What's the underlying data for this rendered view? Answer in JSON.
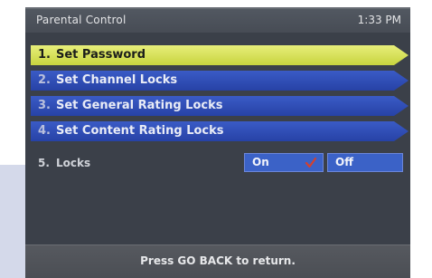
{
  "header": {
    "title": "Parental Control",
    "time": "1:33 PM"
  },
  "menu": {
    "items": [
      {
        "number": "1.",
        "label": "Set Password",
        "selected": true
      },
      {
        "number": "2.",
        "label": "Set Channel Locks",
        "selected": false
      },
      {
        "number": "3.",
        "label": "Set General Rating Locks",
        "selected": false
      },
      {
        "number": "4.",
        "label": "Set Content Rating Locks",
        "selected": false
      }
    ]
  },
  "locks": {
    "number": "5.",
    "label": "Locks",
    "on_label": "On",
    "off_label": "Off",
    "selected": "On"
  },
  "footer": {
    "hint": "Press GO BACK to return."
  },
  "colors": {
    "selected_item": "#d9e35a",
    "menu_item": "#2f4fb8",
    "screen_bg": "#3b4049",
    "check": "#d3412f"
  },
  "icons": {
    "check": "check-icon"
  }
}
